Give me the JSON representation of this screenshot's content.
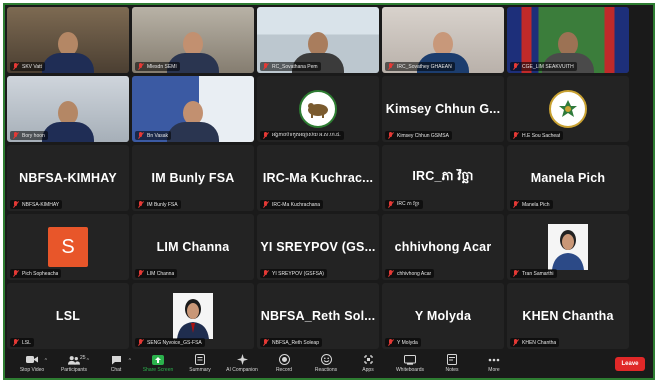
{
  "meeting": {
    "tiles": [
      {
        "label": "SKV Vatt",
        "kind": "video",
        "scene": "office"
      },
      {
        "label": "Mlesdn SEMI",
        "kind": "video",
        "scene": "room"
      },
      {
        "label": "RC_Sovathana Pem",
        "kind": "video",
        "scene": "irc"
      },
      {
        "label": "IRC_Sovathey GHAEAN",
        "kind": "video",
        "scene": "woman"
      },
      {
        "label": "CGE_LIM SEAKVUITH",
        "kind": "video",
        "scene": "flags"
      },
      {
        "label": "Bory hoon",
        "kind": "video",
        "scene": "reading"
      },
      {
        "label": "Bn Vasak",
        "kind": "video",
        "scene": "man"
      },
      {
        "label": "អង្គភាពបិទកូតអធ្យាស័យ អ.ស.ហ.ជ.",
        "kind": "logo-green"
      },
      {
        "label": "Kimsey Chhun GSMSA",
        "name": "Kimsey Chhun G...",
        "kind": "name"
      },
      {
        "label": "H.E Sou Sacheat",
        "kind": "logo-seal"
      },
      {
        "label": "NBFSA-KIMHAY",
        "name": "NBFSA-KIMHAY",
        "kind": "name"
      },
      {
        "label": "IM Bunly FSA",
        "name": "IM Bunly FSA",
        "kind": "name"
      },
      {
        "label": "IRC-Ma Kuchrachana",
        "name": "IRC-Ma Kuchrac...",
        "kind": "name"
      },
      {
        "label": "IRC ភា វិច្ឆា",
        "name": "IRC_ភា វិច្ឆា",
        "kind": "name"
      },
      {
        "label": "Manela Pich",
        "name": "Manela Pich",
        "kind": "name"
      },
      {
        "label": "Pich Sopheacha",
        "avatar_letter": "S",
        "kind": "avatar"
      },
      {
        "label": "LIM Channa",
        "name": "LIM Channa",
        "kind": "name"
      },
      {
        "label": "YI SREYPOV (GSFSA)",
        "name": "YI SREYPOV (GS...",
        "kind": "name"
      },
      {
        "label": "chhivhong Acar",
        "name": "chhivhong Acar",
        "kind": "name"
      },
      {
        "label": "Tran Samarthi",
        "kind": "photo-woman"
      },
      {
        "label": "LSL",
        "name": "LSL",
        "kind": "name"
      },
      {
        "label": "SENG Nyvoice_GS-FSA",
        "kind": "photo-man"
      },
      {
        "label": "NBFSA_Reth Soleap",
        "name": "NBFSA_Reth Sol...",
        "kind": "name"
      },
      {
        "label": "Y Molyda",
        "name": "Y Molyda",
        "kind": "name"
      },
      {
        "label": "KHEN Chantha",
        "name": "KHEN Chantha",
        "kind": "name"
      }
    ]
  },
  "toolbar": {
    "items": [
      {
        "label": "Stop Video",
        "icon": "video-camera-icon",
        "caret": true
      },
      {
        "label": "Participants",
        "icon": "participants-icon",
        "caret": true,
        "count": "25"
      },
      {
        "label": "Chat",
        "icon": "chat-icon",
        "caret": true
      },
      {
        "label": "Share Screen",
        "icon": "share-screen-icon",
        "caret": false
      },
      {
        "label": "Summary",
        "icon": "summary-icon",
        "caret": false
      },
      {
        "label": "AI Companion",
        "icon": "ai-companion-icon",
        "caret": false
      },
      {
        "label": "Record",
        "icon": "record-icon",
        "caret": false
      },
      {
        "label": "Reactions",
        "icon": "reactions-icon",
        "caret": false
      },
      {
        "label": "Apps",
        "icon": "apps-icon",
        "caret": false
      },
      {
        "label": "Whiteboards",
        "icon": "whiteboard-icon",
        "caret": false
      },
      {
        "label": "Notes",
        "icon": "notes-icon",
        "caret": false
      },
      {
        "label": "More",
        "icon": "more-icon",
        "caret": false
      }
    ],
    "leave_label": "Leave"
  },
  "colors": {
    "border_accent": "#2e7d32",
    "muted_mic": "#e53935",
    "share_green": "#2bb24c",
    "leave_red": "#e02828"
  }
}
